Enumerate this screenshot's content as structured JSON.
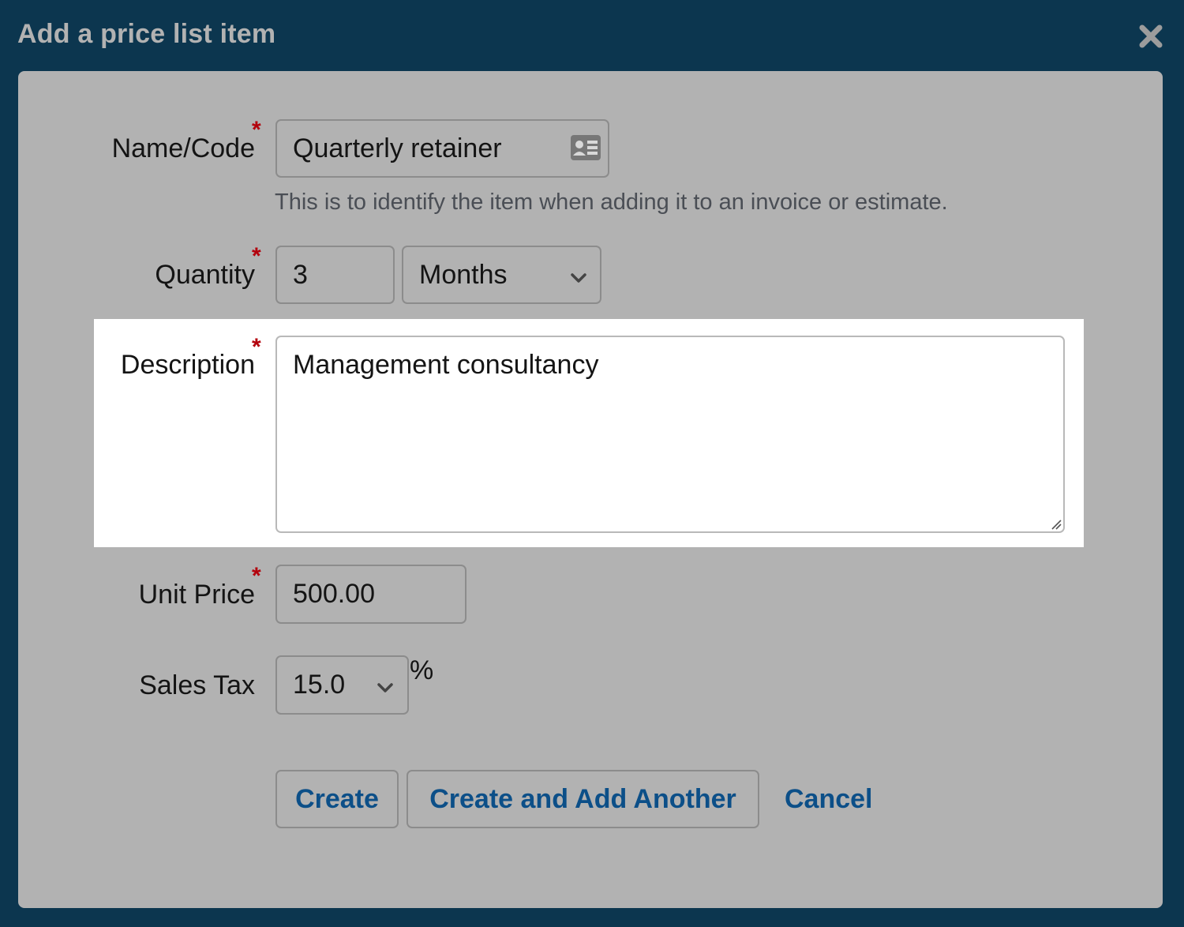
{
  "dialog": {
    "title": "Add a price list item",
    "close_icon": "close-x-icon"
  },
  "form": {
    "name": {
      "label": "Name/Code",
      "required_mark": "*",
      "value": "Quarterly retainer",
      "icon": "contact-card-icon",
      "hint": "This is to identify the item when adding it to an invoice or estimate."
    },
    "quantity": {
      "label": "Quantity",
      "required_mark": "*",
      "value": "3",
      "unit_selected": "Months"
    },
    "description": {
      "label": "Description",
      "required_mark": "*",
      "value": "Management consultancy"
    },
    "unit_price": {
      "label": "Unit Price",
      "required_mark": "*",
      "value": "500.00"
    },
    "sales_tax": {
      "label": "Sales Tax",
      "selected": "15.0",
      "suffix": "%"
    }
  },
  "actions": {
    "create": "Create",
    "create_another": "Create and Add Another",
    "cancel": "Cancel"
  },
  "colors": {
    "header_bg": "#0c364f",
    "overlay_body": "#b2b2b2",
    "required": "#b3000c",
    "link": "#0c4f88",
    "highlight": "#ffffff"
  }
}
